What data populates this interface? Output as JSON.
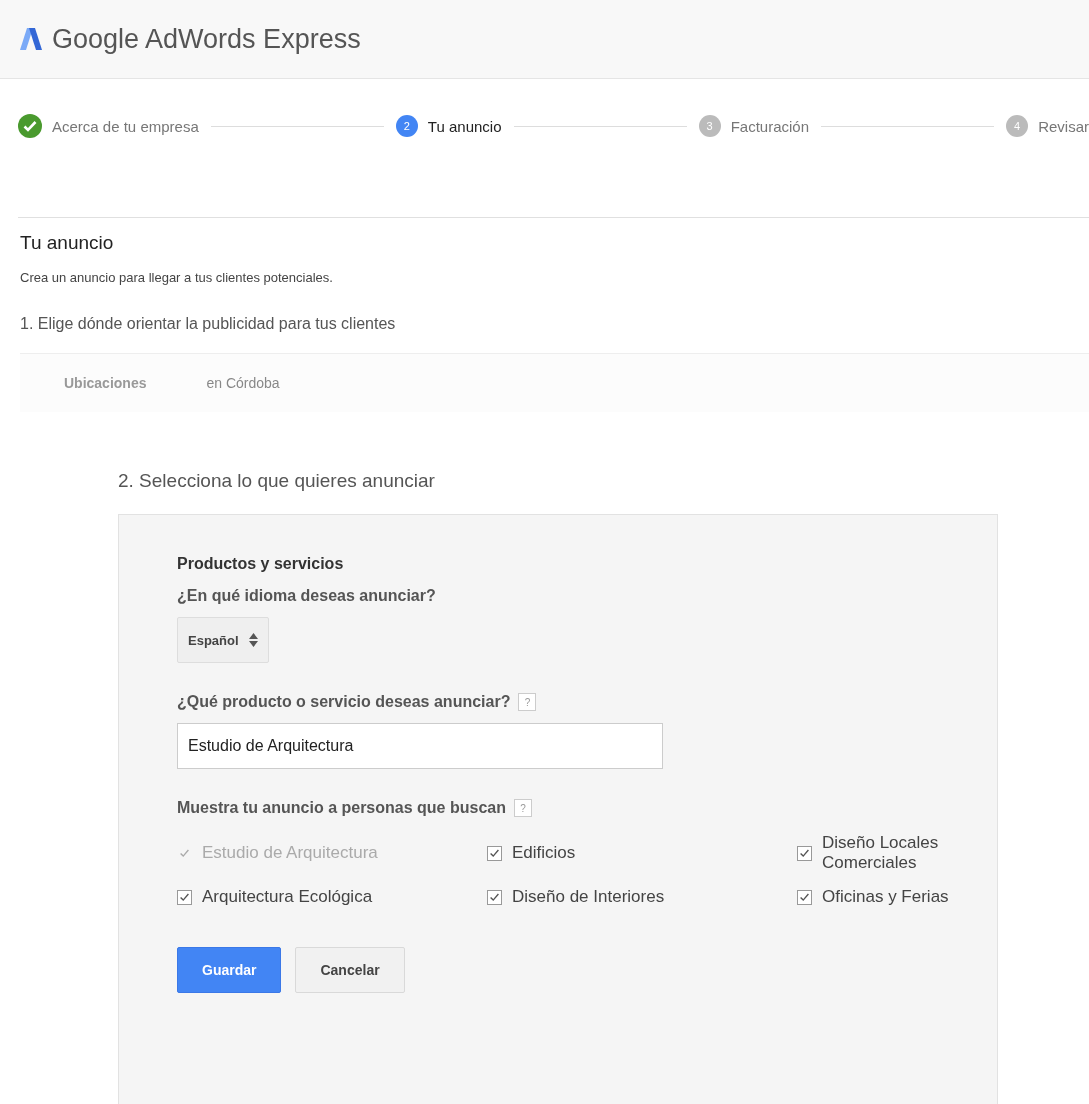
{
  "header": {
    "logo_text": "Google AdWords Express"
  },
  "steps": [
    {
      "label": "Acerca de tu empresa",
      "completed": true,
      "selected": false
    },
    {
      "number": "2",
      "label": "Tu anuncio",
      "completed": false,
      "selected": true
    },
    {
      "number": "3",
      "label": "Facturación",
      "completed": false,
      "selected": false
    },
    {
      "number": "4",
      "label": "Revisar",
      "completed": false,
      "selected": false
    }
  ],
  "page": {
    "title": "Tu anuncio",
    "subtitle": "Crea un anuncio para llegar a tus clientes potenciales."
  },
  "section_1": {
    "title": "1. Elige dónde orientar la publicidad para tus clientes",
    "label": "Ubicaciones",
    "value": "en Córdoba"
  },
  "section_2": {
    "title": "2. Selecciona lo que quieres anunciar",
    "card_title": "Productos y servicios",
    "language_label": "¿En qué idioma deseas anunciar?",
    "language_value": "Español",
    "product_label": "¿Qué producto o servicio deseas anunciar?",
    "product_help": "?",
    "product_value": "Estudio de Arquitectura",
    "keywords_label": "Muestra tu anuncio a personas que buscan",
    "keywords_help": "?",
    "keywords": [
      {
        "label": "Estudio de Arquitectura",
        "checked": true,
        "disabled": true
      },
      {
        "label": "Edificios",
        "checked": true,
        "disabled": false
      },
      {
        "label": "Diseño Locales Comerciales",
        "checked": true,
        "disabled": false
      },
      {
        "label": "Arquitectura Ecológica",
        "checked": true,
        "disabled": false
      },
      {
        "label": "Diseño de Interiores",
        "checked": true,
        "disabled": false
      },
      {
        "label": "Oficinas y Ferias",
        "checked": true,
        "disabled": false
      }
    ],
    "buttons": [
      "Guardar",
      "Cancelar"
    ]
  }
}
